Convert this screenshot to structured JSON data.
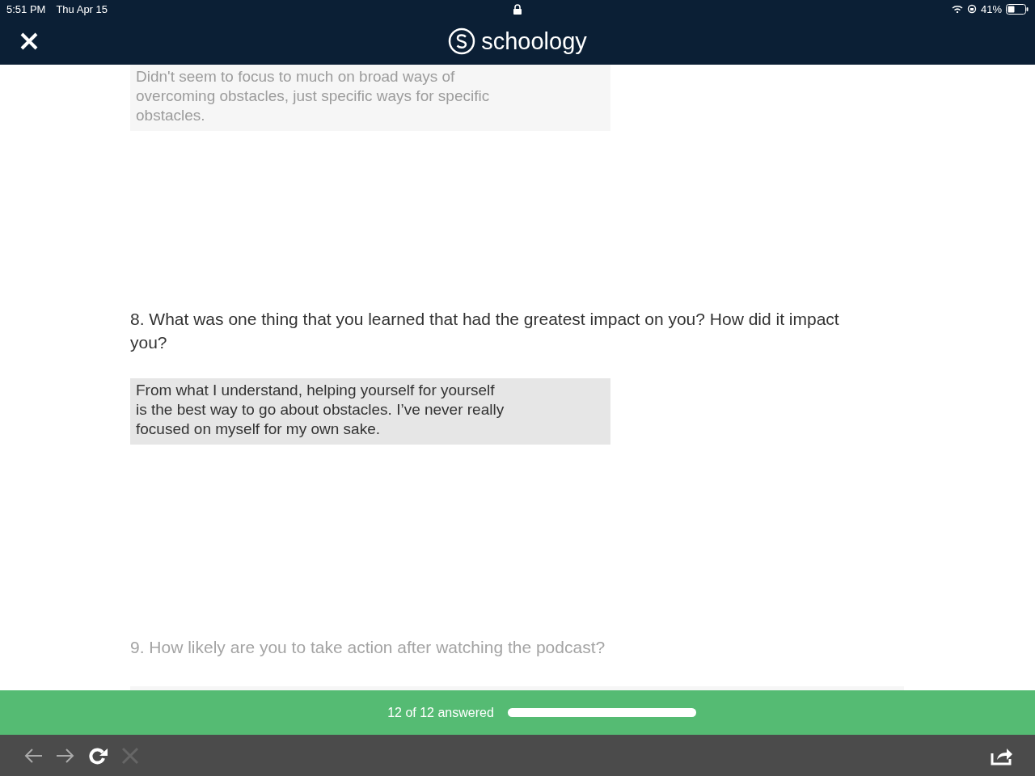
{
  "status_bar": {
    "time": "5:51 PM",
    "date": "Thu Apr 15",
    "battery": "41%"
  },
  "header": {
    "logo_text": "schoology"
  },
  "items": [
    {
      "kind": "answer",
      "dimmed": true,
      "text": "Didn't seem to focus to much on broad ways of overcoming obstacles, just specific ways for specific obstacles."
    },
    {
      "kind": "question",
      "dimmed": false,
      "text": "8. What was one thing that you learned that had the greatest impact on you? How did it impact you?"
    },
    {
      "kind": "answer",
      "dimmed": false,
      "text": "From what I understand, helping yourself for yourself is the best way to go about obstacles. I’ve never really focused on myself for my own sake."
    },
    {
      "kind": "question",
      "dimmed": true,
      "text": "9. How likely are you to take action after watching the podcast?"
    }
  ],
  "progress": {
    "label": "12 of 12 answered",
    "level": 1
  },
  "toolbar": [
    {
      "kind": "back",
      "disabled": false
    },
    {
      "kind": "forward",
      "disabled": false
    },
    {
      "kind": "reload",
      "disabled": false
    },
    {
      "kind": "stop",
      "disabled": true
    }
  ]
}
